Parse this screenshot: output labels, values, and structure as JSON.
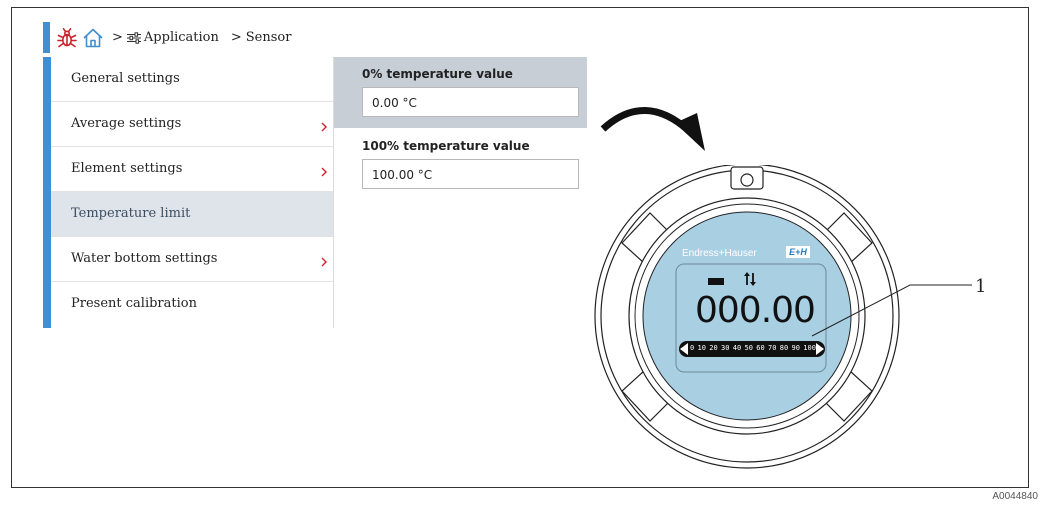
{
  "breadcrumb": {
    "separator": ">",
    "items": [
      "Application",
      "Sensor"
    ]
  },
  "menu": {
    "items": [
      {
        "label": "General settings",
        "has_submenu": false,
        "selected": false
      },
      {
        "label": "Average settings",
        "has_submenu": true,
        "selected": false
      },
      {
        "label": "Element settings",
        "has_submenu": true,
        "selected": false
      },
      {
        "label": "Temperature limit",
        "has_submenu": false,
        "selected": true
      },
      {
        "label": "Water bottom settings",
        "has_submenu": true,
        "selected": false
      },
      {
        "label": "Present calibration",
        "has_submenu": false,
        "selected": false
      }
    ]
  },
  "params": [
    {
      "label": "0% temperature value",
      "value": "0.00 °C",
      "highlighted": true
    },
    {
      "label": "100% temperature value",
      "value": "100.00 °C",
      "highlighted": false
    }
  ],
  "device": {
    "brand": "Endress+Hauser",
    "brand_logo": "E+H",
    "reading": "000.00",
    "bargraph_ticks": [
      "0",
      "10",
      "20",
      "30",
      "40",
      "50",
      "60",
      "70",
      "80",
      "90",
      "100"
    ],
    "status_icons": [
      "status-bar-icon",
      "communication-arrows-icon"
    ]
  },
  "callout_label": "1",
  "figure_id": "A0044840",
  "colors": {
    "accent_blue": "#3f8fd2",
    "selected_row": "#dfe4ea",
    "param_panel": "#c7ced6",
    "display_bg": "#a9cfe3",
    "bug_icon": "#c8232c"
  }
}
